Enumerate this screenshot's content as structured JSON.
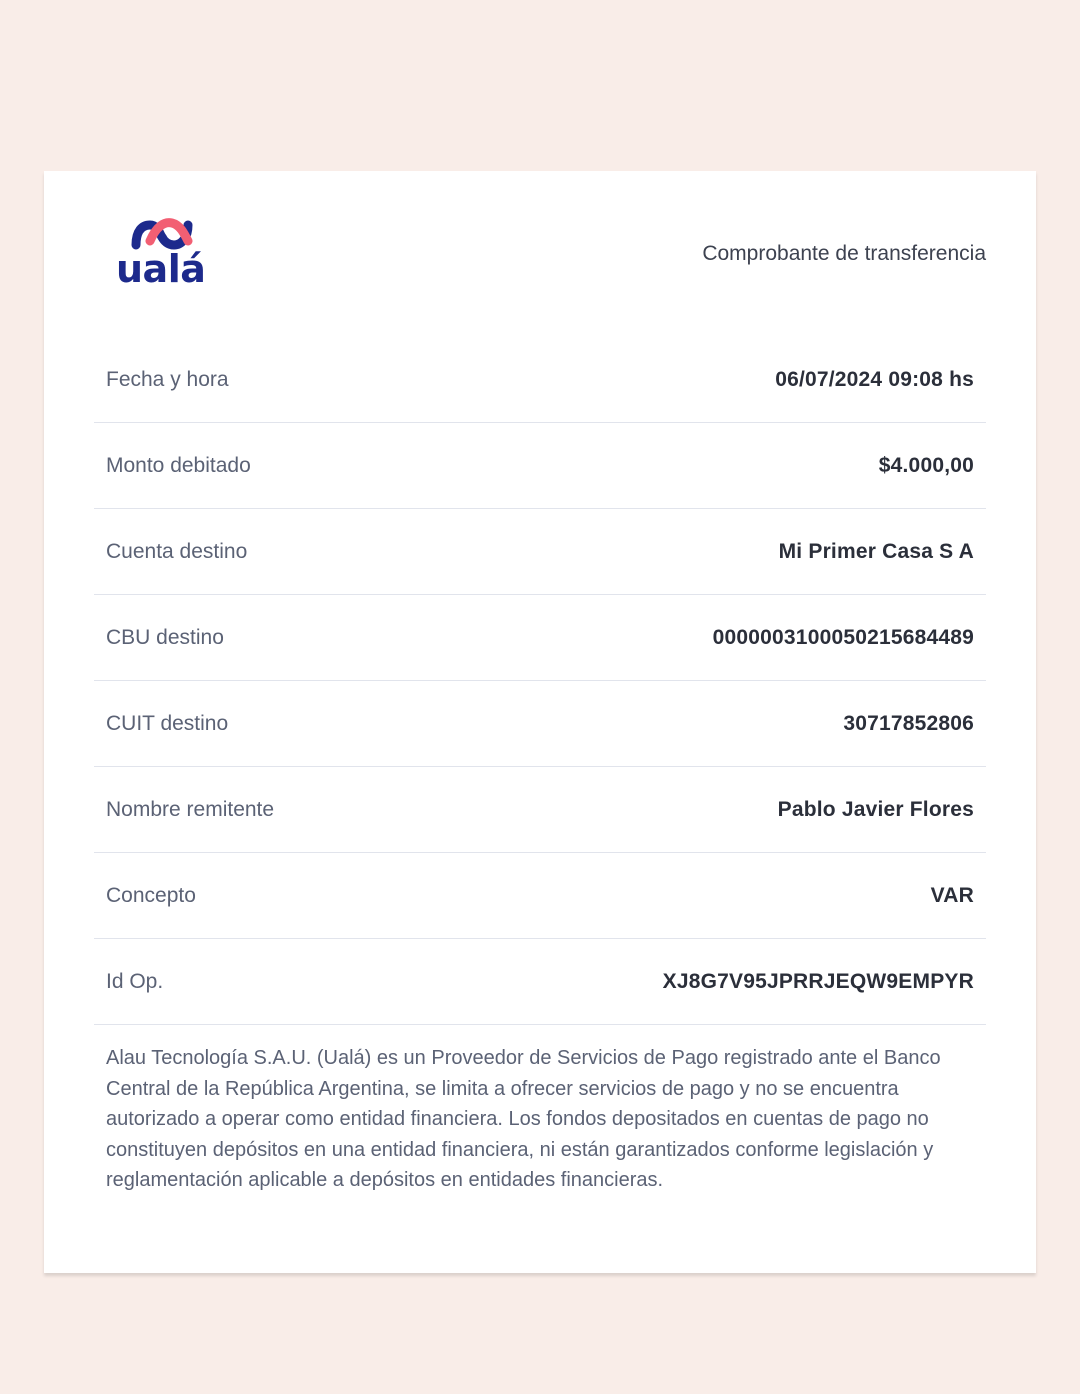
{
  "header": {
    "logo_text": "ualá",
    "title": "Comprobante de transferencia"
  },
  "rows": [
    {
      "label": "Fecha y hora",
      "value": "06/07/2024 09:08 hs"
    },
    {
      "label": "Monto debitado",
      "value": "$4.000,00"
    },
    {
      "label": "Cuenta destino",
      "value": "Mi Primer Casa S A"
    },
    {
      "label": "CBU destino",
      "value": "0000003100050215684489"
    },
    {
      "label": "CUIT destino",
      "value": "30717852806"
    },
    {
      "label": "Nombre remitente",
      "value": "Pablo Javier Flores"
    },
    {
      "label": "Concepto",
      "value": "VAR"
    },
    {
      "label": "Id Op.",
      "value": "XJ8G7V95JPRRJEQW9EMPYR"
    }
  ],
  "disclaimer": "Alau Tecnología S.A.U. (Ualá) es un Proveedor de Servicios de Pago registrado ante el Banco Central de la República Argentina, se limita a ofrecer servicios de pago y no se encuentra autorizado a operar como entidad financiera. Los fondos depositados en cuentas de pago no constituyen depósitos en una entidad financiera, ni están garantizados conforme legislación y reglamentación aplicable a depósitos en entidades financieras.",
  "colors": {
    "background": "#f9ede8",
    "brand_blue": "#1d2a8c",
    "brand_pink": "#f25f73"
  }
}
